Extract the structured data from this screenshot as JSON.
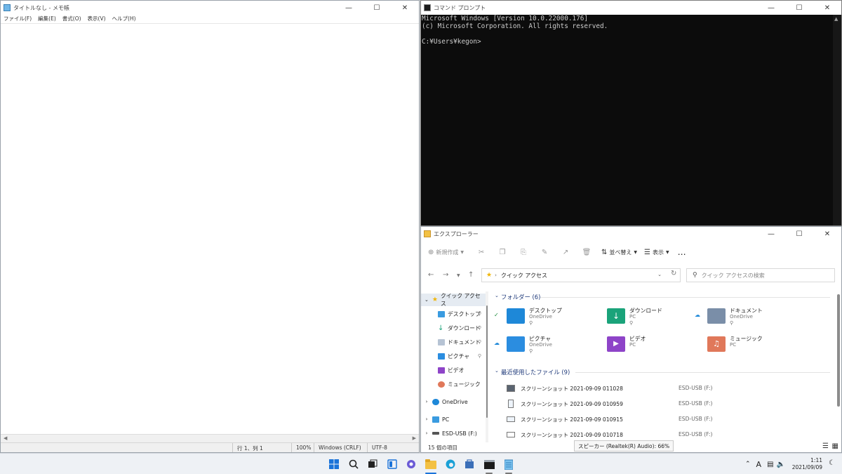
{
  "notepad": {
    "title": "タイトルなし - メモ帳",
    "menu": [
      "ファイル(F)",
      "編集(E)",
      "書式(O)",
      "表示(V)",
      "ヘルプ(H)"
    ],
    "status": {
      "position": "行 1、列 1",
      "zoom": "100%",
      "line_ending": "Windows (CRLF)",
      "encoding": "UTF-8"
    }
  },
  "cmd": {
    "title": "コマンド プロンプト",
    "lines": [
      "Microsoft Windows [Version 10.0.22000.176]",
      "(c) Microsoft Corporation. All rights reserved.",
      "",
      "C:¥Users¥kegon>"
    ]
  },
  "explorer": {
    "title": "エクスプローラー",
    "new_label": "新規作成",
    "sort_label": "並べ替え",
    "view_label": "表示",
    "more_label": "…",
    "address": "クイック アクセス",
    "search_placeholder": "クイック アクセスの検索",
    "nav": {
      "quick_access": "クイック アクセス",
      "items": [
        "デスクトップ",
        "ダウンロード",
        "ドキュメント",
        "ピクチャ",
        "ビデオ",
        "ミュージック"
      ],
      "onedrive": "OneDrive",
      "pc": "PC",
      "usb": "ESD-USB (F:)"
    },
    "folders_header": "フォルダー (6)",
    "folders": [
      {
        "name": "デスクトップ",
        "sub": "OneDrive",
        "color": "#1e88d8"
      },
      {
        "name": "ダウンロード",
        "sub": "PC",
        "color": "#1aa37a"
      },
      {
        "name": "ドキュメント",
        "sub": "OneDrive",
        "color": "#7a8ea8"
      },
      {
        "name": "ピクチャ",
        "sub": "OneDrive",
        "color": "#2b8de0"
      },
      {
        "name": "ビデオ",
        "sub": "PC",
        "color": "#8e44c8"
      },
      {
        "name": "ミュージック",
        "sub": "PC",
        "color": "#e0785a"
      }
    ],
    "recent_header": "最近使用したファイル (9)",
    "recent": [
      {
        "name": "スクリーンショット 2021-09-09 011028",
        "loc": "ESD-USB (F:)"
      },
      {
        "name": "スクリーンショット 2021-09-09 010959",
        "loc": "ESD-USB (F:)"
      },
      {
        "name": "スクリーンショット 2021-09-09 010915",
        "loc": "ESD-USB (F:)"
      },
      {
        "name": "スクリーンショット 2021-09-09 010718",
        "loc": "ESD-USB (F:)"
      }
    ],
    "item_count": "15 個の項目"
  },
  "tooltip": "スピーカー (Realtek(R) Audio): 66%",
  "taskbar": {
    "time": "1:11",
    "date": "2021/09/09",
    "ime": "A"
  }
}
